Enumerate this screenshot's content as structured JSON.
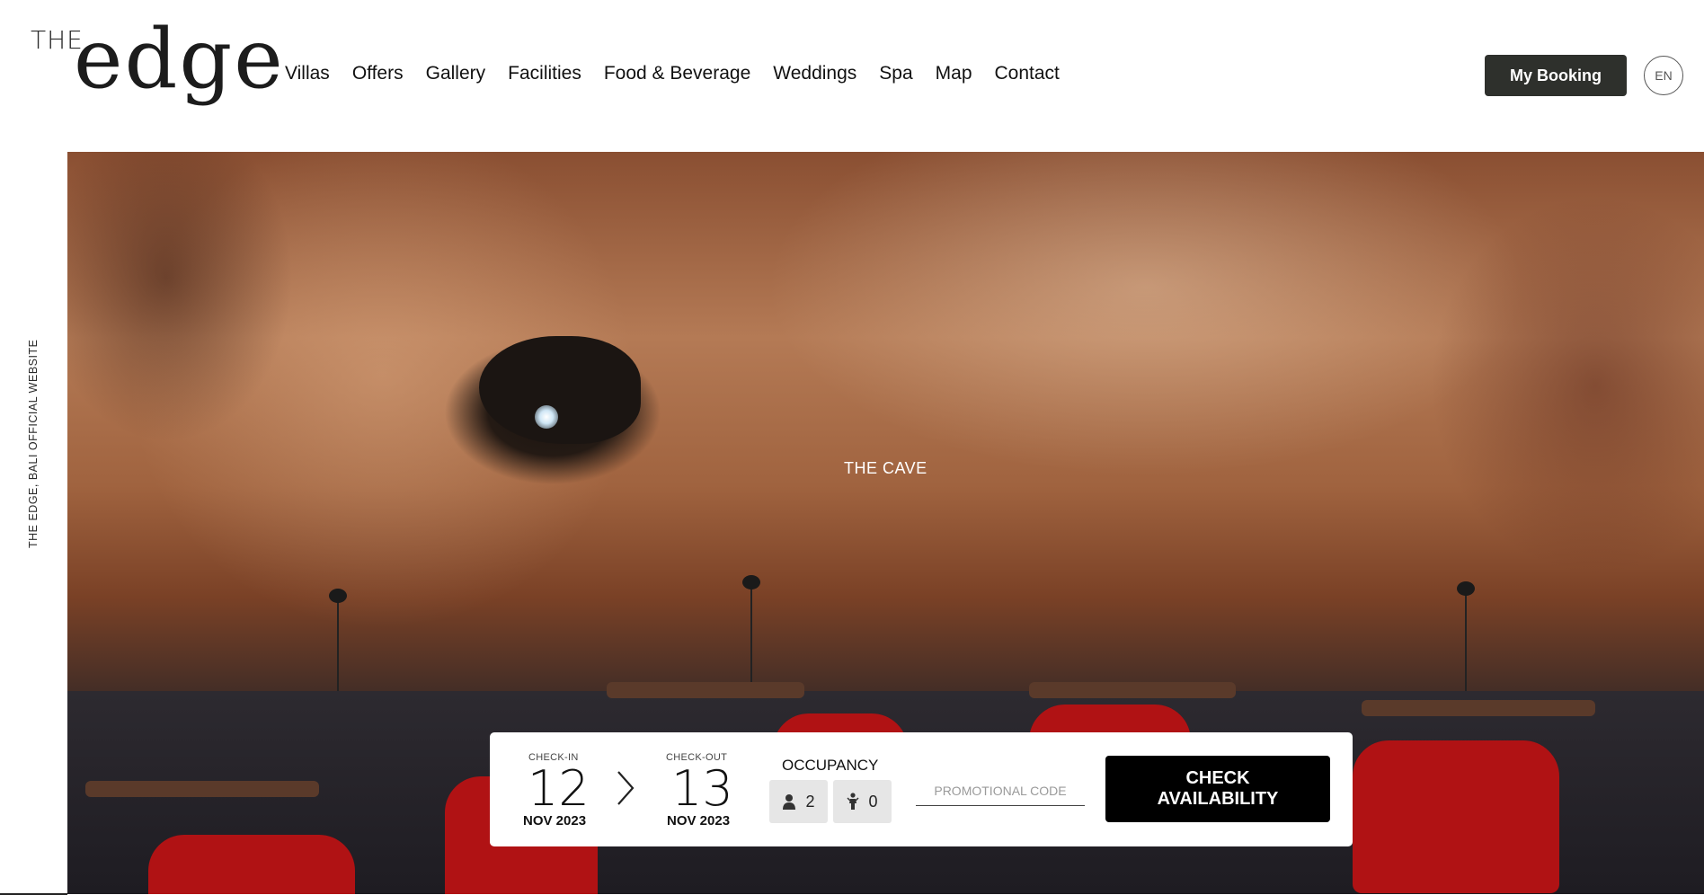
{
  "logo": {
    "top": "THE",
    "main": "edge"
  },
  "nav": {
    "items": [
      "Villas",
      "Offers",
      "Gallery",
      "Facilities",
      "Food & Beverage",
      "Weddings",
      "Spa",
      "Map",
      "Contact"
    ]
  },
  "header": {
    "booking_label": "My Booking",
    "lang_label": "EN"
  },
  "side_text": "THE EDGE, BALI OFFICIAL WEBSITE",
  "hero": {
    "title": "THE CAVE"
  },
  "booking": {
    "checkin_label": "CHECK-IN",
    "checkin_day": "12",
    "checkin_month": "NOV 2023",
    "checkout_label": "CHECK-OUT",
    "checkout_day": "13",
    "checkout_month": "NOV 2023",
    "occupancy_label": "OCCUPANCY",
    "adults": "2",
    "children": "0",
    "promo_placeholder": "PROMOTIONAL CODE",
    "check_label": "CHECK AVAILABILITY"
  },
  "colors": {
    "button_dark": "#2e302c",
    "check_button": "#000000",
    "chair_red": "#b01214"
  }
}
